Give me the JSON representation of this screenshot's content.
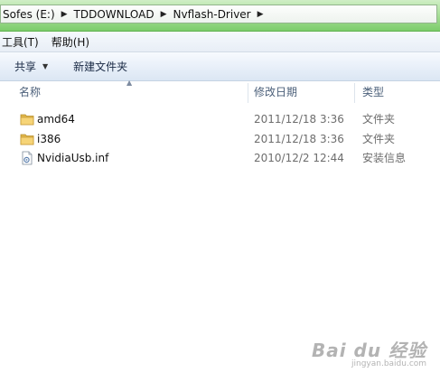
{
  "address_bar": {
    "segments": [
      "Sofes (E:)",
      "TDDOWNLOAD",
      "Nvflash-Driver"
    ]
  },
  "menu": {
    "items": [
      "工具(T)",
      "帮助(H)"
    ]
  },
  "toolbar": {
    "share_label": "共享",
    "new_folder_label": "新建文件夹"
  },
  "columns": {
    "name": "名称",
    "date": "修改日期",
    "type": "类型"
  },
  "files": [
    {
      "name": "amd64",
      "date": "2011/12/18 3:36",
      "type": "文件夹",
      "icon": "folder-icon"
    },
    {
      "name": "i386",
      "date": "2011/12/18 3:36",
      "type": "文件夹",
      "icon": "folder-icon"
    },
    {
      "name": "NvidiaUsb.inf",
      "date": "2010/12/2 12:44",
      "type": "安装信息",
      "icon": "inf-file-icon"
    }
  ],
  "watermark": {
    "main": "Bai du 经验",
    "sub": "jingyan.baidu.com"
  },
  "colors": {
    "titlebar_green": "#a3dd93",
    "toolbar_blue": "#e6eef8",
    "header_text": "#4c607a"
  }
}
